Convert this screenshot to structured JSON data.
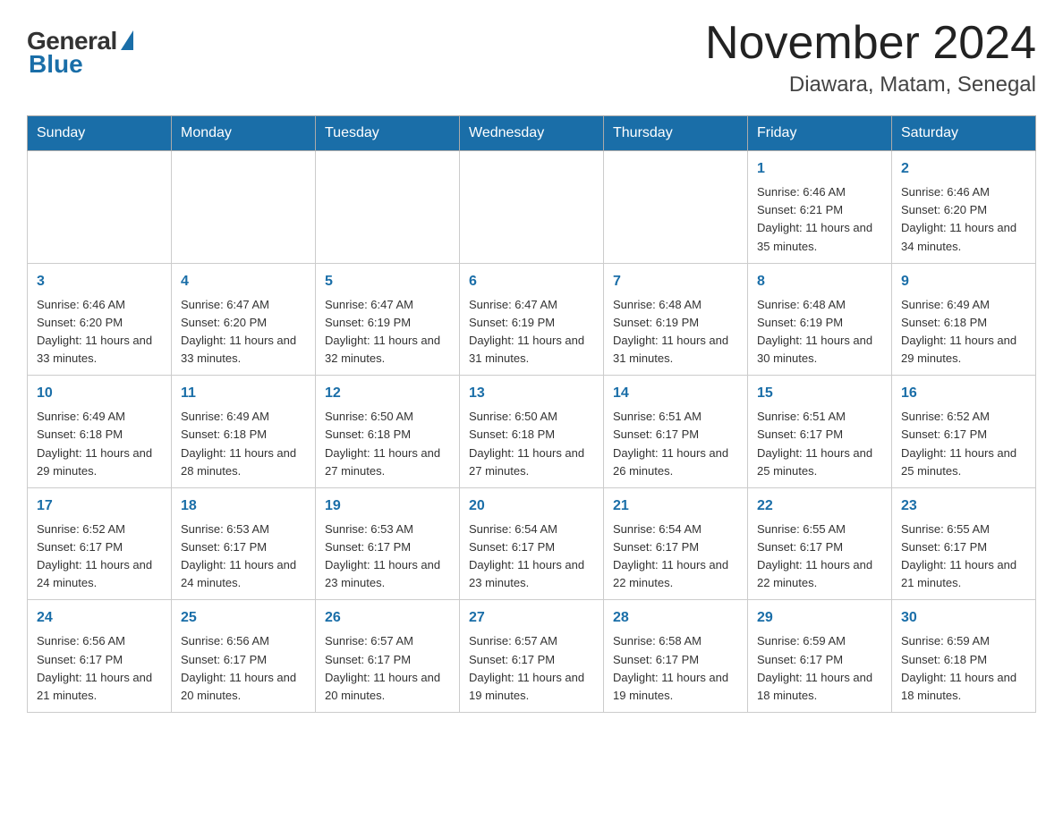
{
  "header": {
    "title": "November 2024",
    "subtitle": "Diawara, Matam, Senegal"
  },
  "weekdays": [
    "Sunday",
    "Monday",
    "Tuesday",
    "Wednesday",
    "Thursday",
    "Friday",
    "Saturday"
  ],
  "weeks": [
    [
      {
        "day": "",
        "info": ""
      },
      {
        "day": "",
        "info": ""
      },
      {
        "day": "",
        "info": ""
      },
      {
        "day": "",
        "info": ""
      },
      {
        "day": "",
        "info": ""
      },
      {
        "day": "1",
        "info": "Sunrise: 6:46 AM\nSunset: 6:21 PM\nDaylight: 11 hours and 35 minutes."
      },
      {
        "day": "2",
        "info": "Sunrise: 6:46 AM\nSunset: 6:20 PM\nDaylight: 11 hours and 34 minutes."
      }
    ],
    [
      {
        "day": "3",
        "info": "Sunrise: 6:46 AM\nSunset: 6:20 PM\nDaylight: 11 hours and 33 minutes."
      },
      {
        "day": "4",
        "info": "Sunrise: 6:47 AM\nSunset: 6:20 PM\nDaylight: 11 hours and 33 minutes."
      },
      {
        "day": "5",
        "info": "Sunrise: 6:47 AM\nSunset: 6:19 PM\nDaylight: 11 hours and 32 minutes."
      },
      {
        "day": "6",
        "info": "Sunrise: 6:47 AM\nSunset: 6:19 PM\nDaylight: 11 hours and 31 minutes."
      },
      {
        "day": "7",
        "info": "Sunrise: 6:48 AM\nSunset: 6:19 PM\nDaylight: 11 hours and 31 minutes."
      },
      {
        "day": "8",
        "info": "Sunrise: 6:48 AM\nSunset: 6:19 PM\nDaylight: 11 hours and 30 minutes."
      },
      {
        "day": "9",
        "info": "Sunrise: 6:49 AM\nSunset: 6:18 PM\nDaylight: 11 hours and 29 minutes."
      }
    ],
    [
      {
        "day": "10",
        "info": "Sunrise: 6:49 AM\nSunset: 6:18 PM\nDaylight: 11 hours and 29 minutes."
      },
      {
        "day": "11",
        "info": "Sunrise: 6:49 AM\nSunset: 6:18 PM\nDaylight: 11 hours and 28 minutes."
      },
      {
        "day": "12",
        "info": "Sunrise: 6:50 AM\nSunset: 6:18 PM\nDaylight: 11 hours and 27 minutes."
      },
      {
        "day": "13",
        "info": "Sunrise: 6:50 AM\nSunset: 6:18 PM\nDaylight: 11 hours and 27 minutes."
      },
      {
        "day": "14",
        "info": "Sunrise: 6:51 AM\nSunset: 6:17 PM\nDaylight: 11 hours and 26 minutes."
      },
      {
        "day": "15",
        "info": "Sunrise: 6:51 AM\nSunset: 6:17 PM\nDaylight: 11 hours and 25 minutes."
      },
      {
        "day": "16",
        "info": "Sunrise: 6:52 AM\nSunset: 6:17 PM\nDaylight: 11 hours and 25 minutes."
      }
    ],
    [
      {
        "day": "17",
        "info": "Sunrise: 6:52 AM\nSunset: 6:17 PM\nDaylight: 11 hours and 24 minutes."
      },
      {
        "day": "18",
        "info": "Sunrise: 6:53 AM\nSunset: 6:17 PM\nDaylight: 11 hours and 24 minutes."
      },
      {
        "day": "19",
        "info": "Sunrise: 6:53 AM\nSunset: 6:17 PM\nDaylight: 11 hours and 23 minutes."
      },
      {
        "day": "20",
        "info": "Sunrise: 6:54 AM\nSunset: 6:17 PM\nDaylight: 11 hours and 23 minutes."
      },
      {
        "day": "21",
        "info": "Sunrise: 6:54 AM\nSunset: 6:17 PM\nDaylight: 11 hours and 22 minutes."
      },
      {
        "day": "22",
        "info": "Sunrise: 6:55 AM\nSunset: 6:17 PM\nDaylight: 11 hours and 22 minutes."
      },
      {
        "day": "23",
        "info": "Sunrise: 6:55 AM\nSunset: 6:17 PM\nDaylight: 11 hours and 21 minutes."
      }
    ],
    [
      {
        "day": "24",
        "info": "Sunrise: 6:56 AM\nSunset: 6:17 PM\nDaylight: 11 hours and 21 minutes."
      },
      {
        "day": "25",
        "info": "Sunrise: 6:56 AM\nSunset: 6:17 PM\nDaylight: 11 hours and 20 minutes."
      },
      {
        "day": "26",
        "info": "Sunrise: 6:57 AM\nSunset: 6:17 PM\nDaylight: 11 hours and 20 minutes."
      },
      {
        "day": "27",
        "info": "Sunrise: 6:57 AM\nSunset: 6:17 PM\nDaylight: 11 hours and 19 minutes."
      },
      {
        "day": "28",
        "info": "Sunrise: 6:58 AM\nSunset: 6:17 PM\nDaylight: 11 hours and 19 minutes."
      },
      {
        "day": "29",
        "info": "Sunrise: 6:59 AM\nSunset: 6:17 PM\nDaylight: 11 hours and 18 minutes."
      },
      {
        "day": "30",
        "info": "Sunrise: 6:59 AM\nSunset: 6:18 PM\nDaylight: 11 hours and 18 minutes."
      }
    ]
  ]
}
